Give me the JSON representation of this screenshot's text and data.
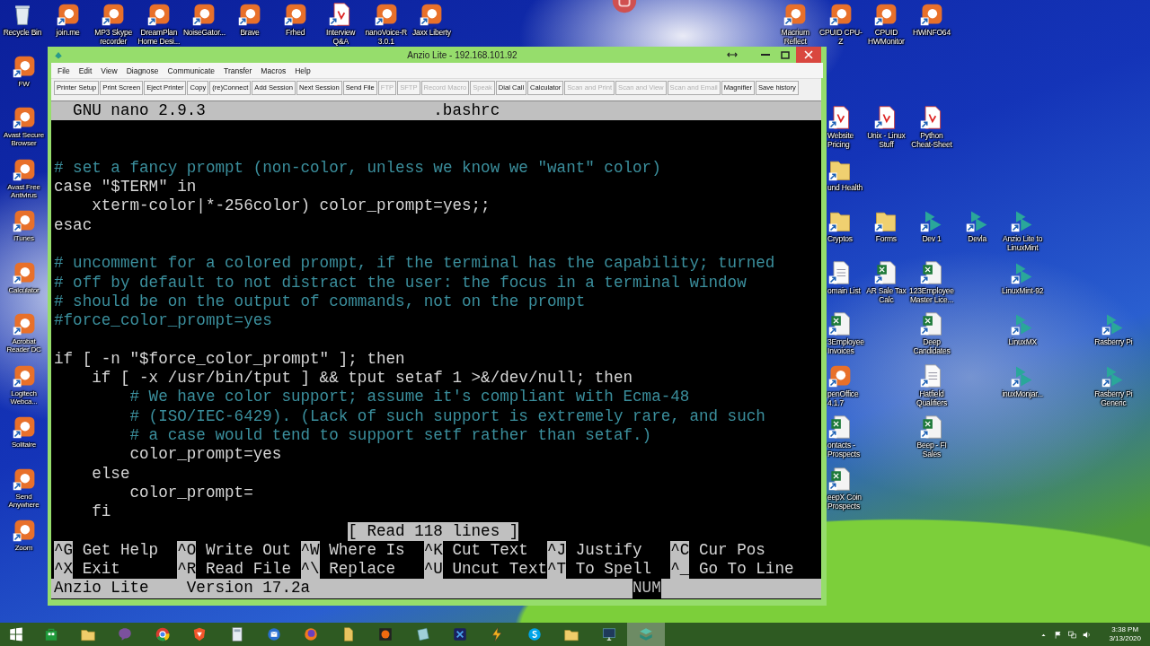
{
  "desktop_icons": [
    {
      "label": "Recycle Bin",
      "kind": "recycle"
    },
    {
      "label": "join.me",
      "kind": "app"
    },
    {
      "label": "MP3 Skype recorder",
      "kind": "app"
    },
    {
      "label": "DreamPlan Home Desi...",
      "kind": "app"
    },
    {
      "label": "NoiseGator...",
      "kind": "app"
    },
    {
      "label": "Brave",
      "kind": "app"
    },
    {
      "label": "Frhed",
      "kind": "app"
    },
    {
      "label": "Interview Q&A",
      "kind": "pdf"
    },
    {
      "label": "nanoVoice-R 3.0.1",
      "kind": "app"
    },
    {
      "label": "Jaxx Liberty",
      "kind": "app"
    },
    {
      "label": "Macrium Reflect",
      "kind": "app"
    },
    {
      "label": "CPUID CPU-Z",
      "kind": "app"
    },
    {
      "label": "CPUID HWMonitor",
      "kind": "app"
    },
    {
      "label": "HWiNFO64",
      "kind": "app"
    },
    {
      "label": "FW",
      "kind": "app"
    },
    {
      "label": "Avast Secure Browser",
      "kind": "app"
    },
    {
      "label": "Avast Free Antivirus",
      "kind": "app"
    },
    {
      "label": "iTunes",
      "kind": "app"
    },
    {
      "label": "Calculator",
      "kind": "app"
    },
    {
      "label": "Acrobat Reader DC",
      "kind": "app"
    },
    {
      "label": "Logitech Webca...",
      "kind": "app"
    },
    {
      "label": "Solitaire",
      "kind": "app"
    },
    {
      "label": "Send Anywhere",
      "kind": "app"
    },
    {
      "label": "Zoom",
      "kind": "app"
    },
    {
      "label": "Website Pricing",
      "kind": "pdf"
    },
    {
      "label": "Unix - Linux Stuff",
      "kind": "pdf"
    },
    {
      "label": "Python Cheat-Sheet",
      "kind": "pdf"
    },
    {
      "label": "und Health",
      "kind": "folder"
    },
    {
      "label": "Cryptos",
      "kind": "folder"
    },
    {
      "label": "Forms",
      "kind": "folder"
    },
    {
      "label": "Dev 1",
      "kind": "teal"
    },
    {
      "label": "Devla",
      "kind": "teal"
    },
    {
      "label": "Anzio Lite to LinuxMint",
      "kind": "teal"
    },
    {
      "label": "omain List",
      "kind": "doc"
    },
    {
      "label": "AR Sale Tax Calc",
      "kind": "sheet"
    },
    {
      "label": "123Employee Master Lice...",
      "kind": "sheet"
    },
    {
      "label": "LinuxMint-92",
      "kind": "teal"
    },
    {
      "label": "3Employee Invoices",
      "kind": "sheet"
    },
    {
      "label": "Deep Candidates",
      "kind": "sheet"
    },
    {
      "label": "LinuxMX",
      "kind": "teal"
    },
    {
      "label": "Rasberry Pi",
      "kind": "teal"
    },
    {
      "label": "penOffice 4.1.7",
      "kind": "app"
    },
    {
      "label": "Hatfield Qualifiers",
      "kind": "doc"
    },
    {
      "label": "inuxMonjar...",
      "kind": "teal"
    },
    {
      "label": "Rasberry Pi Generic",
      "kind": "teal"
    },
    {
      "label": "ontacts - Prospects",
      "kind": "sheet"
    },
    {
      "label": "Beep - FI Sales",
      "kind": "sheet"
    },
    {
      "label": "eepX Coin Prospects",
      "kind": "sheet"
    }
  ],
  "window": {
    "title": "Anzio Lite - 192.168.101.92",
    "menu": [
      "File",
      "Edit",
      "View",
      "Diagnose",
      "Communicate",
      "Transfer",
      "Macros",
      "Help"
    ],
    "toolbar": [
      {
        "label": "Printer Setup",
        "disabled": false
      },
      {
        "label": "Print Screen",
        "disabled": false
      },
      {
        "label": "Eject Printer",
        "disabled": false
      },
      {
        "label": "Copy",
        "disabled": false
      },
      {
        "label": "(re)Connect",
        "disabled": false
      },
      {
        "label": "Add Session",
        "disabled": false
      },
      {
        "label": "Next Session",
        "disabled": false
      },
      {
        "label": "Send File",
        "disabled": false
      },
      {
        "label": "FTP",
        "disabled": true
      },
      {
        "label": "SFTP",
        "disabled": true
      },
      {
        "label": "Record Macro",
        "disabled": true
      },
      {
        "label": "Speak",
        "disabled": true
      },
      {
        "label": "Dial Call",
        "disabled": false
      },
      {
        "label": "Calculator",
        "disabled": false
      },
      {
        "label": "Scan and Print",
        "disabled": true
      },
      {
        "label": "Scan and View",
        "disabled": true
      },
      {
        "label": "Scan and Email",
        "disabled": true
      },
      {
        "label": "Magnifier",
        "disabled": false
      },
      {
        "label": "Save history",
        "disabled": false
      }
    ]
  },
  "editor": {
    "title": "GNU nano 2.9.3",
    "file": ".bashrc",
    "lines": [
      {
        "kind": "blank"
      },
      {
        "kind": "blank"
      },
      {
        "kind": "comment",
        "text": "# set a fancy prompt (non-color, unless we know we \"want\" color)"
      },
      {
        "kind": "code",
        "text": "case \"$TERM\" in"
      },
      {
        "kind": "code",
        "text": "    xterm-color|*-256color) color_prompt=yes;;"
      },
      {
        "kind": "code",
        "text": "esac"
      },
      {
        "kind": "blank"
      },
      {
        "kind": "comment",
        "text": "# uncomment for a colored prompt, if the terminal has the capability; turned"
      },
      {
        "kind": "comment",
        "text": "# off by default to not distract the user: the focus in a terminal window"
      },
      {
        "kind": "comment",
        "text": "# should be on the output of commands, not on the prompt"
      },
      {
        "kind": "comment",
        "text": "#force_color_prompt=yes"
      },
      {
        "kind": "blank"
      },
      {
        "kind": "code",
        "text": "if [ -n \"$force_color_prompt\" ]; then"
      },
      {
        "kind": "code",
        "text": "    if [ -x /usr/bin/tput ] && tput setaf 1 >&/dev/null; then"
      },
      {
        "kind": "comment",
        "text": "        # We have color support; assume it's compliant with Ecma-48"
      },
      {
        "kind": "comment",
        "text": "        # (ISO/IEC-6429). (Lack of such support is extremely rare, and such"
      },
      {
        "kind": "comment",
        "text": "        # a case would tend to support setf rather than setaf.)"
      },
      {
        "kind": "code",
        "text": "        color_prompt=yes"
      },
      {
        "kind": "code",
        "text": "    else"
      },
      {
        "kind": "code",
        "text": "        color_prompt="
      },
      {
        "kind": "code",
        "text": "    fi"
      }
    ],
    "message": "[ Read 118 lines ]",
    "shortcuts": [
      {
        "key": "^G",
        "label": "Get Help"
      },
      {
        "key": "^O",
        "label": "Write Out"
      },
      {
        "key": "^W",
        "label": "Where Is"
      },
      {
        "key": "^K",
        "label": "Cut Text"
      },
      {
        "key": "^J",
        "label": "Justify"
      },
      {
        "key": "^C",
        "label": "Cur Pos"
      },
      {
        "key": "^X",
        "label": "Exit"
      },
      {
        "key": "^R",
        "label": "Read File"
      },
      {
        "key": "^\\",
        "label": "Replace"
      },
      {
        "key": "^U",
        "label": "Uncut Text"
      },
      {
        "key": "^T",
        "label": "To Spell"
      },
      {
        "key": "^_",
        "label": "Go To Line"
      }
    ],
    "status_bar": {
      "app": "Anzio Lite",
      "version": "Version 17.2a",
      "indicator": "NUM"
    }
  },
  "taskbar": {
    "apps": [
      {
        "kind": "windows",
        "selected": false
      },
      {
        "kind": "store",
        "selected": false
      },
      {
        "kind": "folder",
        "selected": false
      },
      {
        "kind": "chat",
        "selected": false
      },
      {
        "kind": "globe",
        "selected": false
      },
      {
        "kind": "shield",
        "selected": false
      },
      {
        "kind": "calc",
        "selected": false
      },
      {
        "kind": "mail",
        "selected": false
      },
      {
        "kind": "browser",
        "selected": false
      },
      {
        "kind": "files",
        "selected": false
      },
      {
        "kind": "orb",
        "selected": false
      },
      {
        "kind": "app",
        "selected": false
      },
      {
        "kind": "x",
        "selected": false
      },
      {
        "kind": "bolt",
        "selected": false
      },
      {
        "kind": "circle",
        "selected": false
      },
      {
        "kind": "folder",
        "selected": false
      },
      {
        "kind": "monitor",
        "selected": false
      },
      {
        "kind": "terminal",
        "selected": true
      }
    ],
    "time": "3:38 PM",
    "date": "3/13/2020"
  }
}
